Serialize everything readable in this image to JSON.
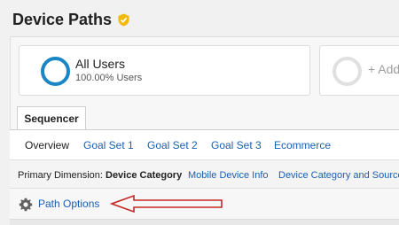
{
  "page": {
    "title": "Device Paths",
    "verified_icon": "shield-check-icon"
  },
  "segments": {
    "primary": {
      "name": "All Users",
      "percent_text": "100.00% Users",
      "ring_color": "#1a86c4"
    },
    "add_label": "+ Add"
  },
  "sequencer_tab": "Sequencer",
  "tabs": [
    {
      "label": "Overview"
    },
    {
      "label": "Goal Set 1"
    },
    {
      "label": "Goal Set 2"
    },
    {
      "label": "Goal Set 3"
    },
    {
      "label": "Ecommerce"
    }
  ],
  "dimension": {
    "label": "Primary Dimension:",
    "active": "Device Category",
    "links": [
      "Mobile Device Info",
      "Device Category and Source"
    ]
  },
  "path_options": {
    "label": "Path Options",
    "icon": "gear-icon"
  },
  "colors": {
    "link": "#1a5fb4",
    "badge": "#f2b80a",
    "annotation_arrow": "#c62828"
  }
}
